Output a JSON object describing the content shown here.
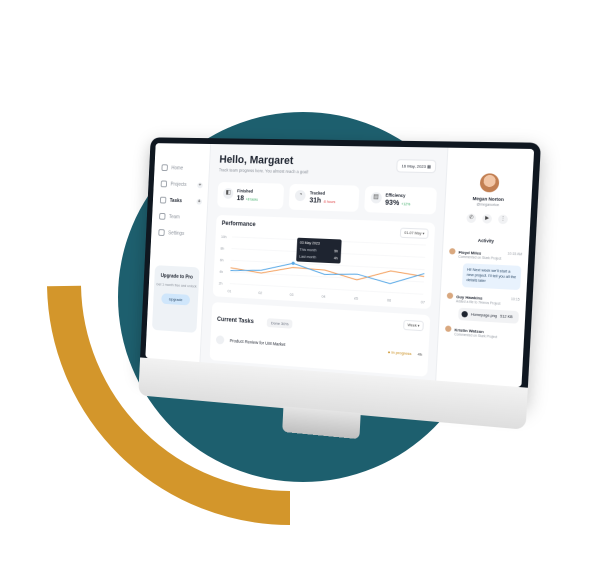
{
  "colors": {
    "teal": "#1d5f6e",
    "gold": "#d3962b",
    "accent": "#2f80ed",
    "chart_orange": "#f4a261",
    "chart_blue": "#5aa9e6"
  },
  "sidebar": {
    "items": [
      {
        "label": "Home",
        "icon": "home-icon"
      },
      {
        "label": "Projects",
        "icon": "folder-icon"
      },
      {
        "label": "Tasks",
        "icon": "tasks-icon"
      },
      {
        "label": "Team",
        "icon": "team-icon"
      },
      {
        "label": "Settings",
        "icon": "gear-icon"
      }
    ],
    "upgrade": {
      "title": "Upgrade to Pro",
      "subtitle": "Get 1 month free and unlock",
      "button": "Upgrade"
    }
  },
  "header": {
    "greeting": "Hello, Margaret",
    "subtitle": "Track team progress here. You almost reach a goal!",
    "date": "16 May, 2023"
  },
  "stats": [
    {
      "label": "Finished",
      "value": "18",
      "delta": "+8 tasks",
      "trend": "up"
    },
    {
      "label": "Tracked",
      "value": "31h",
      "delta": "-6 hours",
      "trend": "down"
    },
    {
      "label": "Efficiency",
      "value": "93%",
      "delta": "+12%",
      "trend": "up"
    }
  ],
  "performance": {
    "title": "Performance",
    "range": "01-07 May",
    "tooltip": {
      "date": "03 May 2023",
      "row1": "This month",
      "row1_value": "5h",
      "row2": "Last month",
      "row2_value": "4h"
    }
  },
  "chart_data": {
    "type": "line",
    "x": [
      "01",
      "02",
      "03",
      "04",
      "05",
      "06",
      "07"
    ],
    "series": [
      {
        "values": [
          3.4,
          2.6,
          4.1,
          3.9,
          2.2,
          4.4,
          3.6
        ]
      },
      {
        "values": [
          2.8,
          3.2,
          5.0,
          3.0,
          3.4,
          1.8,
          4.2
        ]
      }
    ],
    "yticks": [
      "10h",
      "8h",
      "6h",
      "4h",
      "2h"
    ],
    "ylim": [
      0,
      10
    ]
  },
  "tasks": {
    "title": "Current Tasks",
    "count": "Done 30%",
    "period": "Week",
    "rows": [
      {
        "name": "Product Review for UI8 Market",
        "status": "In progress",
        "hours": "4h"
      }
    ]
  },
  "profile": {
    "name": "Megan Norton",
    "role": "@meganorton"
  },
  "activity": {
    "title": "Activity",
    "messages": [
      {
        "name": "Floyd Miles",
        "time": "10:15 AM",
        "sub": "Commented on Stark Project",
        "text": "Hi! Next week we'll start a new project. I'll tell you all the details later"
      },
      {
        "name": "Guy Hawkins",
        "time": "10:15",
        "sub": "Added a file to 7Heros Project",
        "file": "Homepage.png",
        "file_size": "512 KB"
      },
      {
        "name": "Kristin Watson",
        "time": "",
        "sub": "Commented on Stark Project"
      }
    ]
  }
}
